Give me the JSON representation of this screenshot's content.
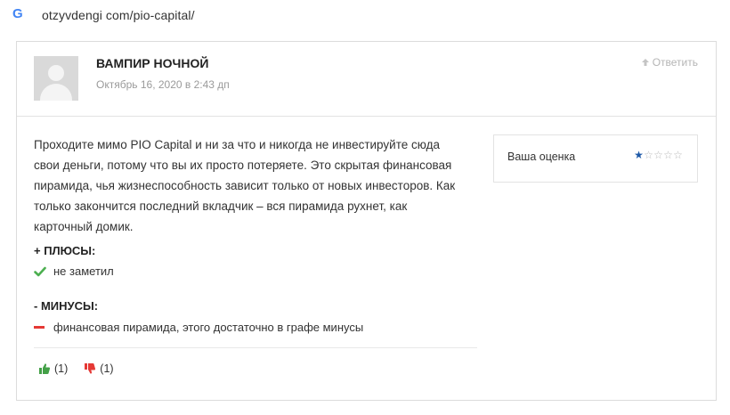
{
  "browser": {
    "icon": "google-g-icon",
    "url": "otzyvdengi com/pio-capital/"
  },
  "review": {
    "author": "ВАМПИР НОЧНОЙ",
    "date": "Октябрь 16, 2020 в 2:43 дп",
    "reply_label": "Ответить",
    "text": "Проходите мимо PIO Capital и ни за что и никогда не инвестируйте сюда свои деньги, потому что вы их просто потеряете. Это скрытая финансовая пирамида, чья жизнеспособность зависит только от новых инвесторов. Как только закончится последний вкладчик – вся пирамида рухнет, как карточный домик.",
    "pros_title": "+ ПЛЮСЫ:",
    "pros_item": "не заметил",
    "cons_title": "- МИНУСЫ:",
    "cons_item": "финансовая пирамида, этого достаточно в графе минусы",
    "likes": "(1)",
    "dislikes": "(1)"
  },
  "rating": {
    "label": "Ваша оценка",
    "value": 1,
    "max": 5
  },
  "colors": {
    "google_blue": "#4285F4",
    "check_green": "#4caf50",
    "minus_red": "#e53935",
    "like_green": "#43a047",
    "dislike_red": "#e53935",
    "star_blue": "#1f5aa8"
  }
}
